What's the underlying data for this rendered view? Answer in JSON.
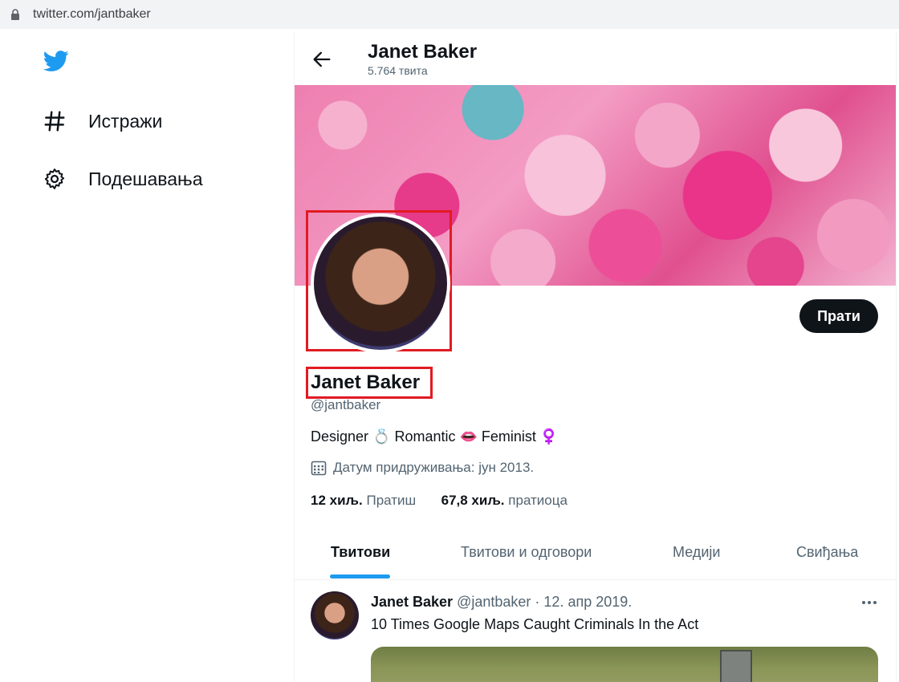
{
  "browser": {
    "url": "twitter.com/jantbaker"
  },
  "nav": {
    "items": [
      {
        "label": "Истражи",
        "icon": "hashtag-icon"
      },
      {
        "label": "Подешавања",
        "icon": "gear-icon"
      }
    ]
  },
  "header": {
    "name": "Janet Baker",
    "tweet_count": "5.764 твита"
  },
  "profile": {
    "name": "Janet Baker",
    "handle": "@jantbaker",
    "bio": "Designer 💍 Romantic 👄 Feminist ♀️",
    "joined": "Датум придруживања: јун 2013.",
    "following_count": "12 хиљ.",
    "following_label": "Пратиш",
    "followers_count": "67,8 хиљ.",
    "followers_label": "пратиоца",
    "follow_button": "Прати"
  },
  "tabs": [
    {
      "label": "Твитови",
      "active": true
    },
    {
      "label": "Твитови и одговори",
      "active": false
    },
    {
      "label": "Медији",
      "active": false
    },
    {
      "label": "Свиђања",
      "active": false
    }
  ],
  "tweet": {
    "author": "Janet Baker",
    "handle": "@jantbaker",
    "date": "· 12. апр 2019.",
    "text": "10 Times Google Maps Caught Criminals In the Act"
  },
  "colors": {
    "accent": "#1d9bf0",
    "highlight_box": "#e11b22",
    "button": "#0f1419"
  }
}
